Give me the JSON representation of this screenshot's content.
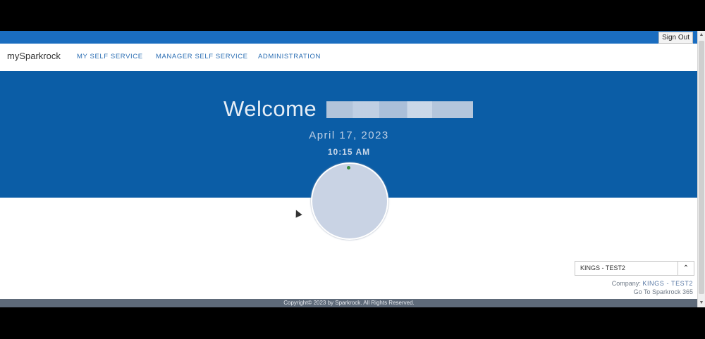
{
  "topbar": {
    "sign_out_label": "Sign Out"
  },
  "navbar": {
    "brand": "mySparkrock",
    "items": [
      {
        "label": "MY SELF SERVICE"
      },
      {
        "label": "MANAGER SELF SERVICE"
      },
      {
        "label": "ADMINISTRATION"
      }
    ]
  },
  "hero": {
    "welcome": "Welcome",
    "date": "April 17, 2023",
    "time": "10:15 AM"
  },
  "company": {
    "selected": "KINGS - TEST2",
    "label": "Company:",
    "name": "KINGS - TEST2",
    "goto_link": "Go To Sparkrock 365"
  },
  "footer": {
    "copyright": "Copyright© 2023 by Sparkrock. All Rights Reserved."
  },
  "colors": {
    "topbar": "#1a6dc0",
    "hero": "#0b5da6",
    "nav_link": "#2a6db3",
    "footer": "#5e6a79"
  },
  "icons": {
    "select_toggle": "chevron-up-icon"
  }
}
